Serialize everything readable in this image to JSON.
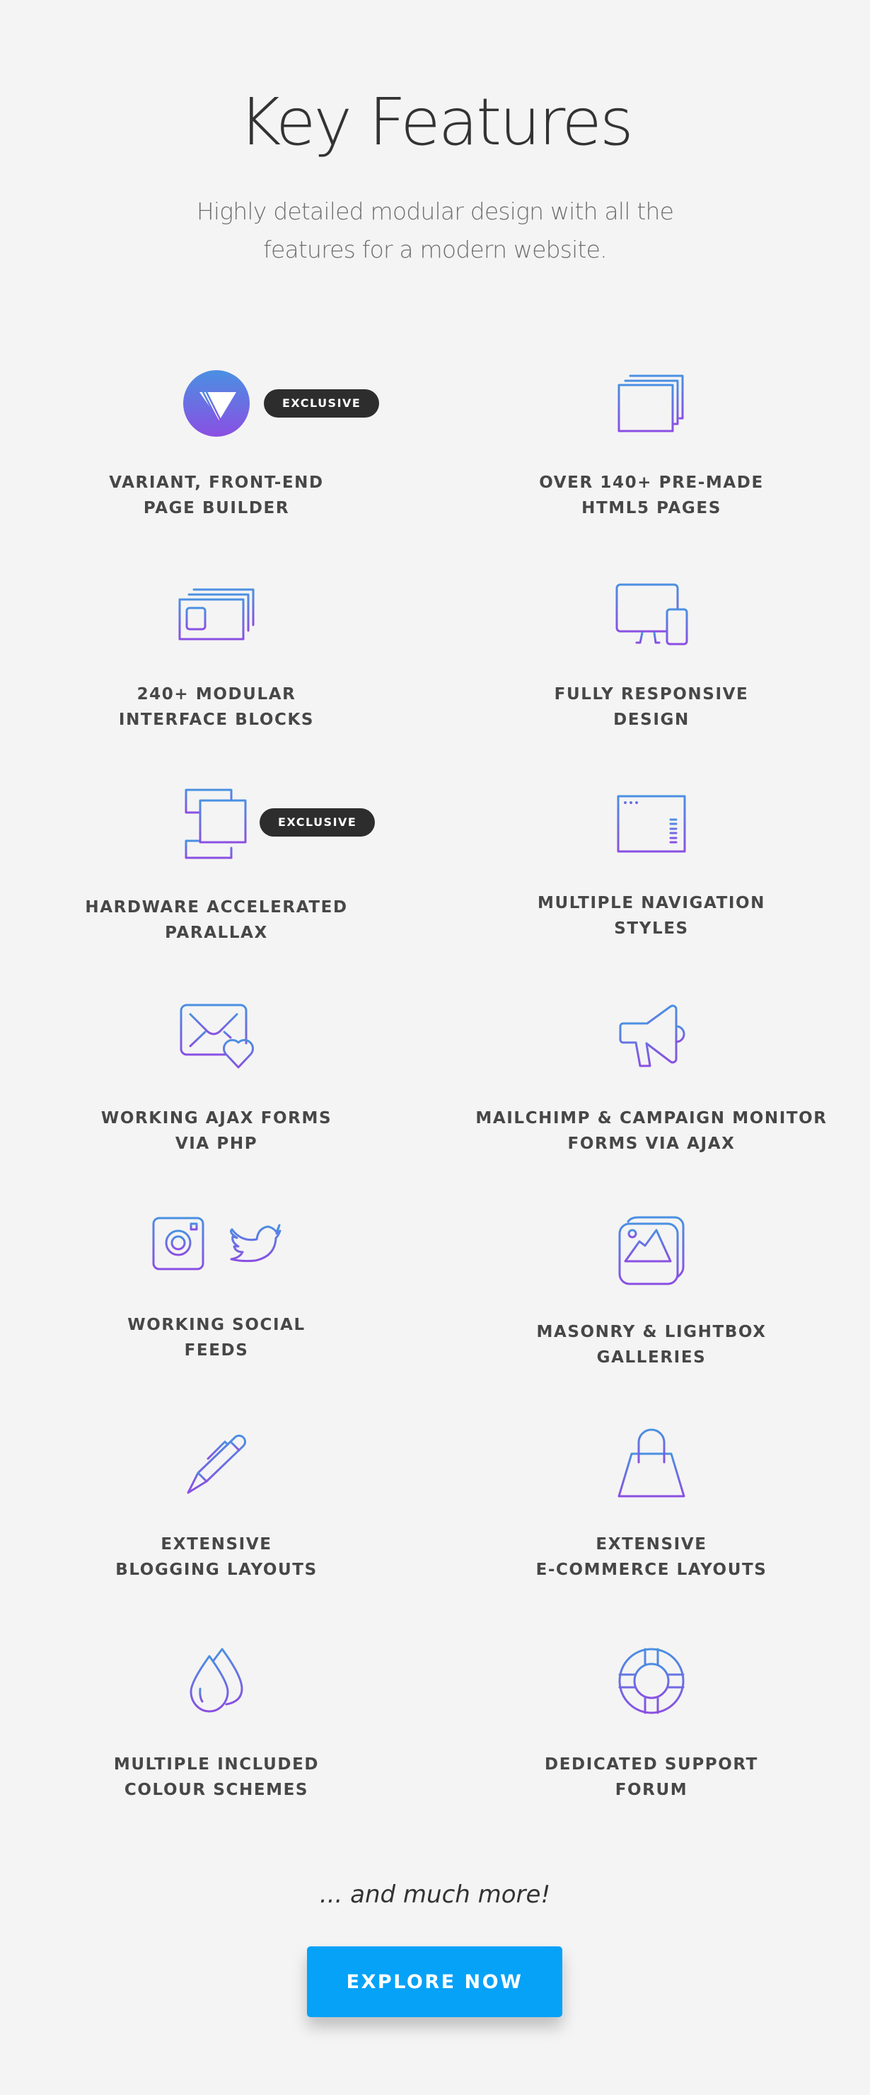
{
  "header": {
    "title": "Key Features",
    "subtitle_lines": [
      "Highly detailed modular design with all the",
      "features for a modern website."
    ]
  },
  "theme": {
    "background": "#f4f4f4",
    "icon_gradient_top": "#4a90e2",
    "icon_gradient_bottom": "#8a4fe3",
    "badge_background": "#2d2d2d",
    "cta_background": "#06a2f8"
  },
  "features": [
    {
      "icon": "variant-logo-icon",
      "badge": "EXCLUSIVE",
      "lines": [
        "VARIANT, FRONT-END",
        "PAGE BUILDER"
      ]
    },
    {
      "icon": "stacked-windows-icon",
      "lines": [
        "OVER 140+ PRE-MADE",
        "HTML5 PAGES"
      ]
    },
    {
      "icon": "interface-blocks-icon",
      "lines": [
        "240+ MODULAR",
        "INTERFACE BLOCKS"
      ]
    },
    {
      "icon": "responsive-devices-icon",
      "lines": [
        "FULLY RESPONSIVE",
        "DESIGN"
      ]
    },
    {
      "icon": "parallax-layers-icon",
      "badge": "EXCLUSIVE",
      "lines": [
        "HARDWARE ACCELERATED",
        "PARALLAX"
      ]
    },
    {
      "icon": "navigation-window-icon",
      "lines": [
        "MULTIPLE NAVIGATION",
        "STYLES"
      ]
    },
    {
      "icon": "envelope-heart-icon",
      "lines": [
        "WORKING AJAX FORMS",
        "VIA PHP"
      ]
    },
    {
      "icon": "megaphone-icon",
      "lines": [
        "MAILCHIMP & CAMPAIGN MONITOR",
        "FORMS VIA AJAX"
      ]
    },
    {
      "icon": "instagram-twitter-icon",
      "lines": [
        "WORKING SOCIAL",
        "FEEDS"
      ]
    },
    {
      "icon": "image-gallery-icon",
      "lines": [
        "MASONRY & LIGHTBOX",
        "GALLERIES"
      ]
    },
    {
      "icon": "pen-icon",
      "lines": [
        "EXTENSIVE",
        "BLOGGING LAYOUTS"
      ]
    },
    {
      "icon": "shopping-bag-icon",
      "lines": [
        "EXTENSIVE",
        "E-COMMERCE LAYOUTS"
      ]
    },
    {
      "icon": "color-drops-icon",
      "lines": [
        "MULTIPLE INCLUDED",
        "COLOUR SCHEMES"
      ]
    },
    {
      "icon": "lifebuoy-icon",
      "lines": [
        "DEDICATED SUPPORT",
        "FORUM"
      ]
    }
  ],
  "footer": {
    "more_text": "... and much more!",
    "cta_label": "EXPLORE NOW"
  }
}
